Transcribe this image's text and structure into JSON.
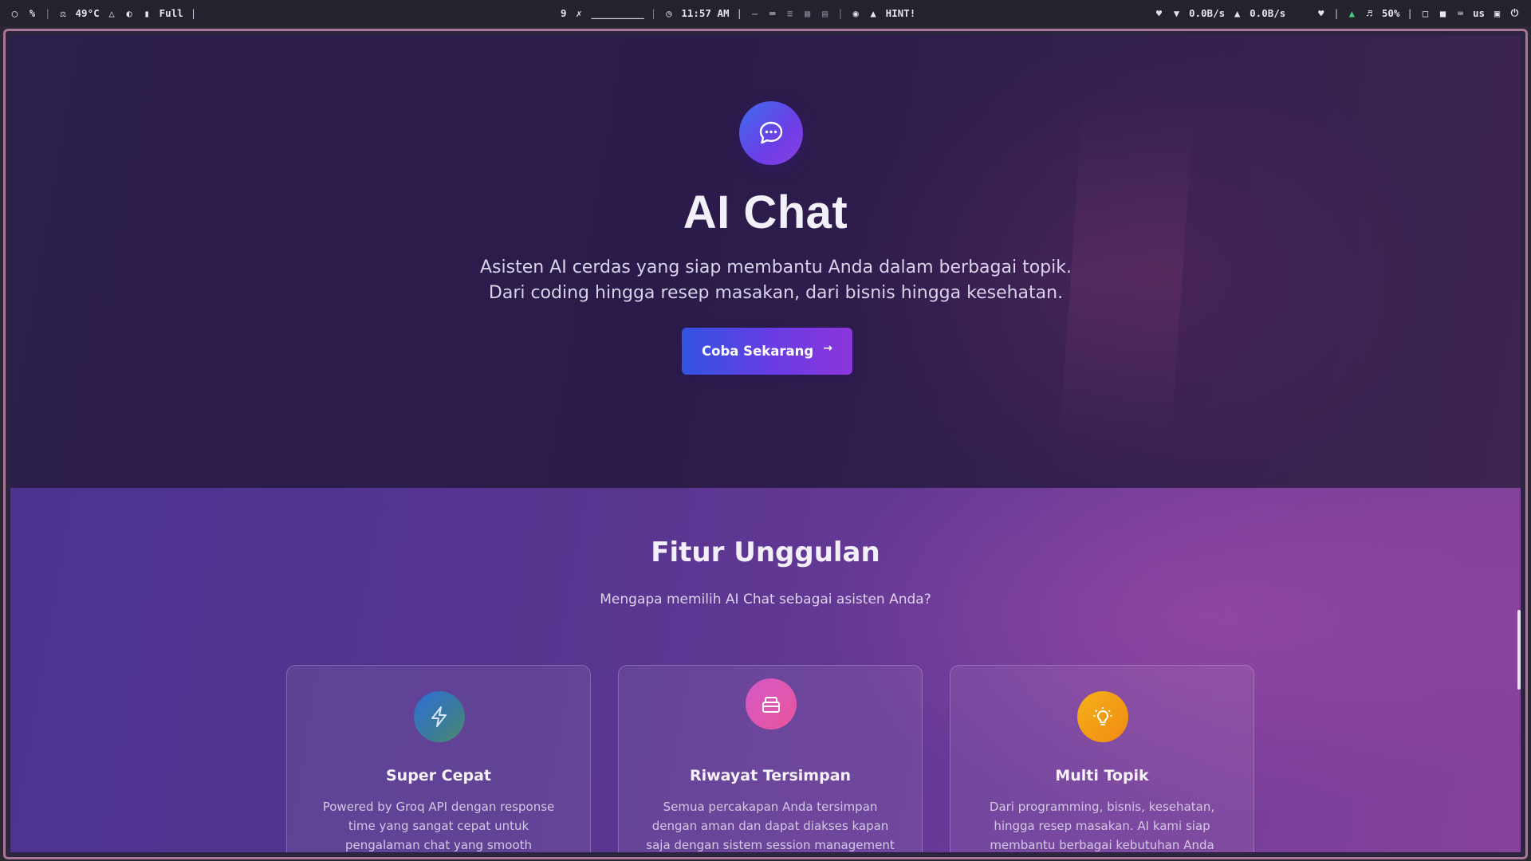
{
  "statusbar": {
    "left": {
      "temperature": "49°C",
      "mode": "Full",
      "separator": "|"
    },
    "center": {
      "workspace": "9",
      "underline": "__________",
      "clock": "11:57 AM",
      "separator": "|",
      "hint": "HINT!"
    },
    "right": {
      "net_down": "0.0B/s",
      "net_up": "0.0B/s",
      "volume": "50%",
      "separator": "|",
      "layout": "us"
    }
  },
  "hero": {
    "title": "AI Chat",
    "subtitle": "Asisten AI cerdas yang siap membantu Anda dalam berbagai topik. Dari coding hingga resep masakan, dari bisnis hingga kesehatan.",
    "cta_label": "Coba Sekarang",
    "cta_arrow": "→"
  },
  "features": {
    "title": "Fitur Unggulan",
    "subtitle": "Mengapa memilih AI Chat sebagai asisten Anda?",
    "cards": [
      {
        "icon": "lightning-icon",
        "title": "Super Cepat",
        "desc": "Powered by Groq API dengan response time yang sangat cepat untuk pengalaman chat yang smooth"
      },
      {
        "icon": "archive-icon",
        "title": "Riwayat Tersimpan",
        "desc": "Semua percakapan Anda tersimpan dengan aman dan dapat diakses kapan saja dengan sistem session management"
      },
      {
        "icon": "lightbulb-icon",
        "title": "Multi Topik",
        "desc": "Dari programming, bisnis, kesehatan, hingga resep masakan. AI kami siap membantu berbagai kebutuhan Anda"
      }
    ]
  },
  "colors": {
    "hero_bg": "#2b1b4a",
    "features_bg": "#56358f",
    "cta_start": "#3153e0",
    "cta_end": "#8b36da",
    "window_border": "#a87796"
  }
}
